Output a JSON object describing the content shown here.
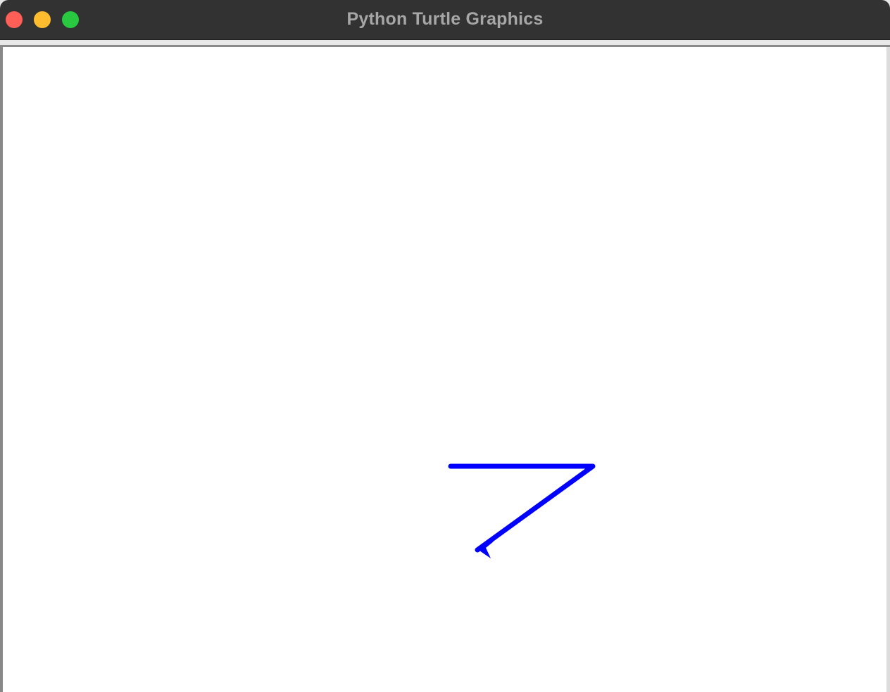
{
  "window": {
    "title": "Python Turtle Graphics"
  },
  "traffic_lights": {
    "close_color": "#ff5f57",
    "minimize_color": "#febc2e",
    "zoom_color": "#28c840"
  },
  "turtle": {
    "pen_color": "#0000ff",
    "shape": "classic"
  }
}
